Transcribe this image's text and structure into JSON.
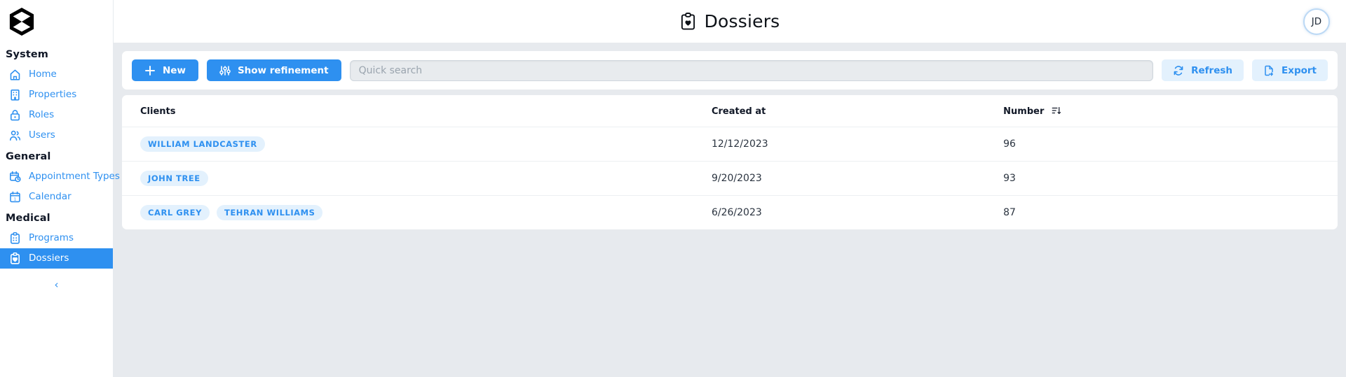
{
  "brand": {
    "logo_icon": "hexagon-bowtie-logo"
  },
  "sidebar": {
    "groups": [
      {
        "label": "System",
        "items": [
          {
            "label": "Home",
            "icon": "home-icon",
            "active": false
          },
          {
            "label": "Properties",
            "icon": "building-icon",
            "active": false
          },
          {
            "label": "Roles",
            "icon": "lock-icon",
            "active": false
          },
          {
            "label": "Users",
            "icon": "users-icon",
            "active": false
          }
        ]
      },
      {
        "label": "General",
        "items": [
          {
            "label": "Appointment Types",
            "icon": "calendar-clock-icon",
            "active": false
          },
          {
            "label": "Calendar",
            "icon": "calendar-icon",
            "active": false
          }
        ]
      },
      {
        "label": "Medical",
        "items": [
          {
            "label": "Programs",
            "icon": "clipboard-list-icon",
            "active": false
          },
          {
            "label": "Dossiers",
            "icon": "clipboard-heart-icon",
            "active": true
          }
        ]
      }
    ],
    "collapse_label": "‹",
    "collapse_icon": "chevron-left-icon"
  },
  "header": {
    "title": "Dossiers",
    "title_icon": "clipboard-heart-icon",
    "avatar_initials": "JD"
  },
  "toolbar": {
    "new_label": "New",
    "new_icon": "plus-icon",
    "refinement_label": "Show refinement",
    "refinement_icon": "sliders-icon",
    "search_placeholder": "Quick search",
    "search_value": "",
    "refresh_label": "Refresh",
    "refresh_icon": "refresh-icon",
    "export_label": "Export",
    "export_icon": "file-export-icon"
  },
  "table": {
    "columns": [
      {
        "label": "Clients",
        "sorted": false
      },
      {
        "label": "Created at",
        "sorted": false
      },
      {
        "label": "Number",
        "sorted": true,
        "sort_icon": "sort-descending-icon"
      }
    ],
    "rows": [
      {
        "clients": [
          "William Landcaster"
        ],
        "created_at": "12/12/2023",
        "number": "96"
      },
      {
        "clients": [
          "John Tree"
        ],
        "created_at": "9/20/2023",
        "number": "93"
      },
      {
        "clients": [
          "Carl Grey",
          "Tehran Williams"
        ],
        "created_at": "6/26/2023",
        "number": "87"
      }
    ]
  },
  "colors": {
    "accent": "#2e90f0",
    "accent_soft": "#e3f1fd",
    "page_bg": "#e7eaee",
    "card_bg": "#ffffff",
    "text": "#111827"
  }
}
